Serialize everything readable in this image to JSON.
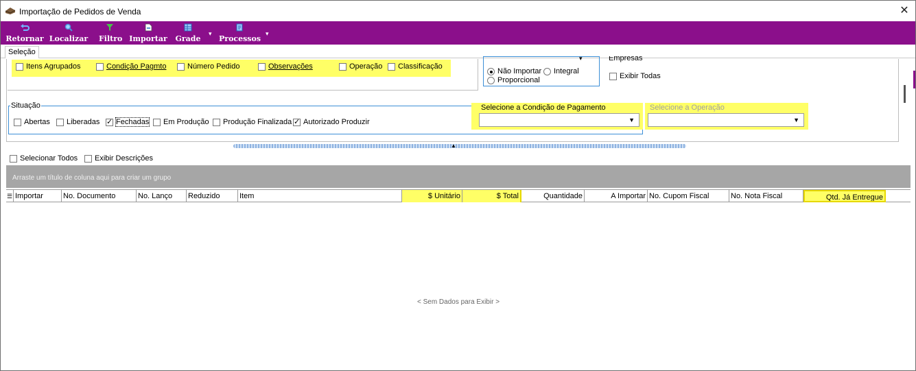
{
  "window": {
    "title": "Importação de Pedidos de Venda",
    "close_glyph": "✕"
  },
  "toolbar": {
    "items": [
      {
        "label": "Retornar",
        "icon": "return-icon"
      },
      {
        "label": "Localizar",
        "icon": "search-icon"
      },
      {
        "label": "Filtro",
        "icon": "filter-icon"
      },
      {
        "label": "Importar",
        "icon": "import-icon"
      },
      {
        "label": "Grade",
        "icon": "grid-icon"
      },
      {
        "label": "Processos",
        "icon": "process-icon"
      }
    ],
    "dropdown_glyph": "▾"
  },
  "tabs": [
    {
      "label": "Seleção",
      "active": true
    }
  ],
  "group_options": {
    "items": [
      {
        "label": "Itens Agrupados",
        "checked": false
      },
      {
        "label": "Condição Pagmto",
        "checked": false
      },
      {
        "label": "Número Pedido",
        "checked": false
      },
      {
        "label": "Observações",
        "checked": false
      },
      {
        "label": "Operação",
        "checked": false
      },
      {
        "label": "Classificação",
        "checked": false
      }
    ]
  },
  "import_mode": {
    "options": [
      {
        "label": "Não Importar",
        "selected": true
      },
      {
        "label": "Integral",
        "selected": false
      },
      {
        "label": "Proporcional",
        "selected": false
      }
    ]
  },
  "empresas": {
    "title": "Empresas",
    "exibir_todas": {
      "label": "Exibir Todas",
      "checked": false
    }
  },
  "situacao": {
    "title": "Situação",
    "items": [
      {
        "label": "Abertas",
        "checked": false
      },
      {
        "label": "Liberadas",
        "checked": false
      },
      {
        "label": "Fechadas",
        "checked": true
      },
      {
        "label": "Em Produção",
        "checked": false
      },
      {
        "label": "Produção Finalizada",
        "checked": false
      },
      {
        "label": "Autorizado Produzir",
        "checked": true
      }
    ]
  },
  "condicao_pagamento": {
    "title": "Selecione a Condição de Pagamento",
    "value": ""
  },
  "operacao": {
    "title": "Selecione a Operação",
    "value": ""
  },
  "grid": {
    "selecionar_todos": {
      "label": "Selecionar Todos",
      "checked": false
    },
    "exibir_descricoes": {
      "label": "Exibir Descrições",
      "checked": false
    },
    "group_hint": "Arraste um título de coluna aqui para criar um grupo",
    "columns": [
      "Importar",
      "No. Documento",
      "No. Lanço",
      "Reduzido",
      "Item",
      "$ Unitário",
      "$ Total",
      "Quantidade",
      "A Importar",
      "No. Cupom Fiscal",
      "No. Nota Fiscal",
      "Qtd. Já Entregue"
    ],
    "empty_text": "< Sem Dados para Exibir >"
  },
  "colors": {
    "toolbar": "#8b0f8b",
    "highlight": "#ffff66",
    "group_border": "#3b8ed6",
    "group_bar": "#a6a6a6"
  }
}
